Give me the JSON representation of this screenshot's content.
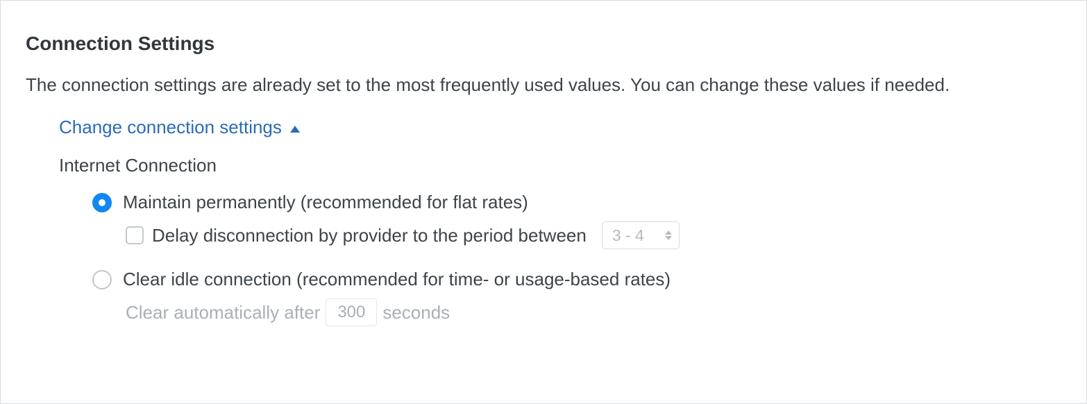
{
  "panel": {
    "title": "Connection Settings",
    "description": "The connection settings are already set to the most frequently used values. You can change these values if needed.",
    "toggle_label": "Change connection settings"
  },
  "internet": {
    "heading": "Internet Connection",
    "option_maintain": "Maintain permanently (recommended for flat rates)",
    "delay_label": "Delay disconnection by provider to the period between",
    "delay_select_value": "3 - 4",
    "option_clear": "Clear idle connection (recommended for time- or usage-based rates)",
    "clear_prefix": "Clear automatically after",
    "clear_value": "300",
    "clear_suffix": "seconds"
  }
}
